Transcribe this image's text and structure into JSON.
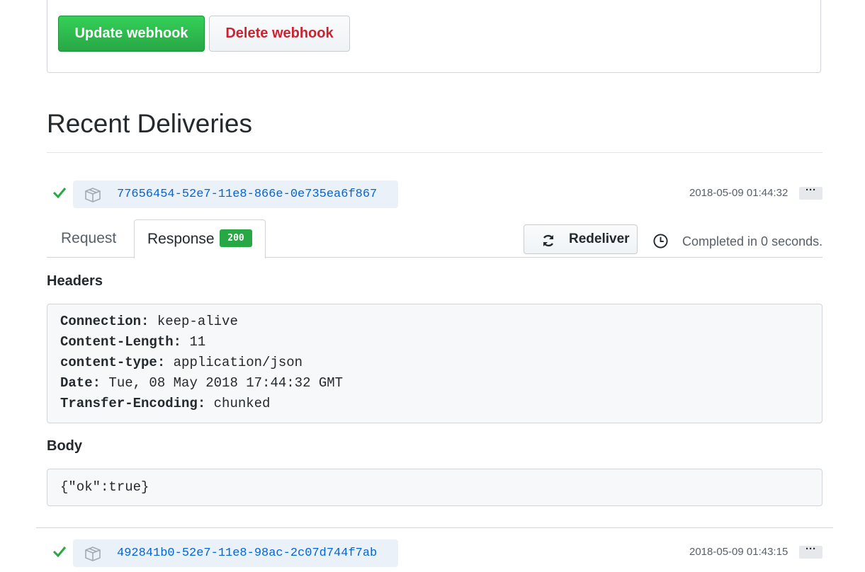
{
  "form": {
    "update_label": "Update webhook",
    "delete_label": "Delete webhook"
  },
  "section_title": "Recent Deliveries",
  "deliveries": [
    {
      "status_icon": "check-icon",
      "guid": "77656454-52e7-11e8-866e-0e735ea6f867",
      "timestamp": "2018-05-09 01:44:32",
      "menu_label": "···",
      "tabs": [
        "Request",
        "Response"
      ],
      "response_code": "200",
      "redeliver_label": "Redeliver",
      "completed_text": "Completed in 0 seconds.",
      "headers_title": "Headers",
      "headers": [
        {
          "key": "Connection:",
          "value": "keep-alive"
        },
        {
          "key": "Content-Length:",
          "value": "11"
        },
        {
          "key": "content-type:",
          "value": "application/json"
        },
        {
          "key": "Date:",
          "value": "Tue, 08 May 2018 17:44:32 GMT"
        },
        {
          "key": "Transfer-Encoding:",
          "value": "chunked"
        }
      ],
      "body_title": "Body",
      "body": "{\"ok\":true}"
    },
    {
      "status_icon": "check-icon",
      "guid": "492841b0-52e7-11e8-98ac-2c07d744f7ab",
      "timestamp": "2018-05-09 01:43:15",
      "menu_label": "···"
    }
  ],
  "colors": {
    "success": "#28a745",
    "danger": "#cb2431",
    "link": "#0366d6"
  }
}
